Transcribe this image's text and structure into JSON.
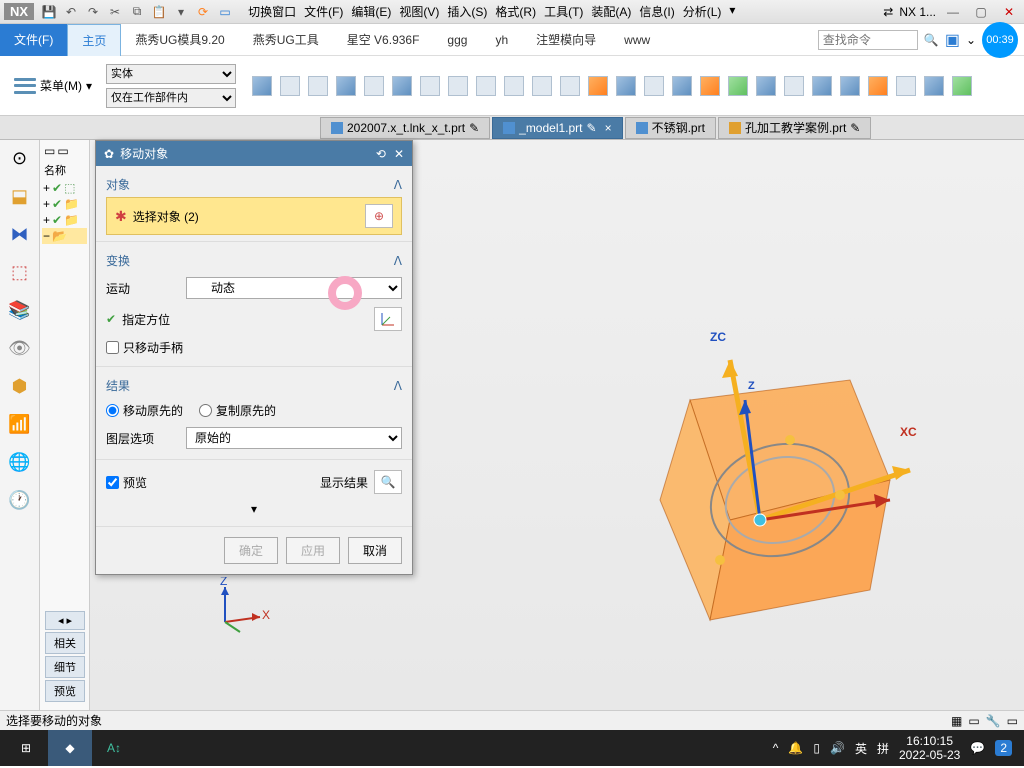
{
  "app": {
    "logo": "NX",
    "title_suffix": "NX 1..."
  },
  "menubar": {
    "items": [
      "切换窗口",
      "文件(F)",
      "编辑(E)",
      "视图(V)",
      "插入(S)",
      "格式(R)",
      "工具(T)",
      "装配(A)",
      "信息(I)",
      "分析(L)"
    ]
  },
  "ribbon": {
    "file": "文件(F)",
    "tabs": [
      "主页",
      "燕秀UG模具9.20",
      "燕秀UG工具",
      "星空 V6.936F",
      "ggg",
      "yh",
      "注塑模向导",
      "www"
    ],
    "active_tab": 0,
    "search_placeholder": "查找命令",
    "timer": "00:39",
    "menu_label": "菜单(M)",
    "filter1": "实体",
    "filter2": "仅在工作部件内"
  },
  "doc_tabs": [
    {
      "label": "202007.x_t.lnk_x_t.prt",
      "active": false
    },
    {
      "label": "_model1.prt",
      "active": true
    },
    {
      "label": "不锈钢.prt",
      "active": false
    },
    {
      "label": "孔加工教学案例.prt",
      "active": false
    }
  ],
  "tree": {
    "header": "名称"
  },
  "dialog": {
    "title": "移动对象",
    "sec_object": "对象",
    "select_label": "选择对象 (2)",
    "sec_transform": "变换",
    "motion_label": "运动",
    "motion_value": "动态",
    "orient_label": "指定方位",
    "handle_only": "只移动手柄",
    "sec_result": "结果",
    "radio_move": "移动原先的",
    "radio_copy": "复制原先的",
    "layer_label": "图层选项",
    "layer_value": "原始的",
    "preview": "预览",
    "show_result": "显示结果",
    "btn_ok": "确定",
    "btn_apply": "应用",
    "btn_cancel": "取消"
  },
  "axes": {
    "zc": "ZC",
    "xc": "XC",
    "z": "Z",
    "x": "X"
  },
  "side_labels": [
    "相关",
    "细节",
    "预览"
  ],
  "status": {
    "prompt": "选择要移动的对象"
  },
  "taskbar": {
    "ime": "英",
    "ime2": "拼",
    "time": "16:10:15",
    "date": "2022-05-23",
    "badge": "2"
  }
}
